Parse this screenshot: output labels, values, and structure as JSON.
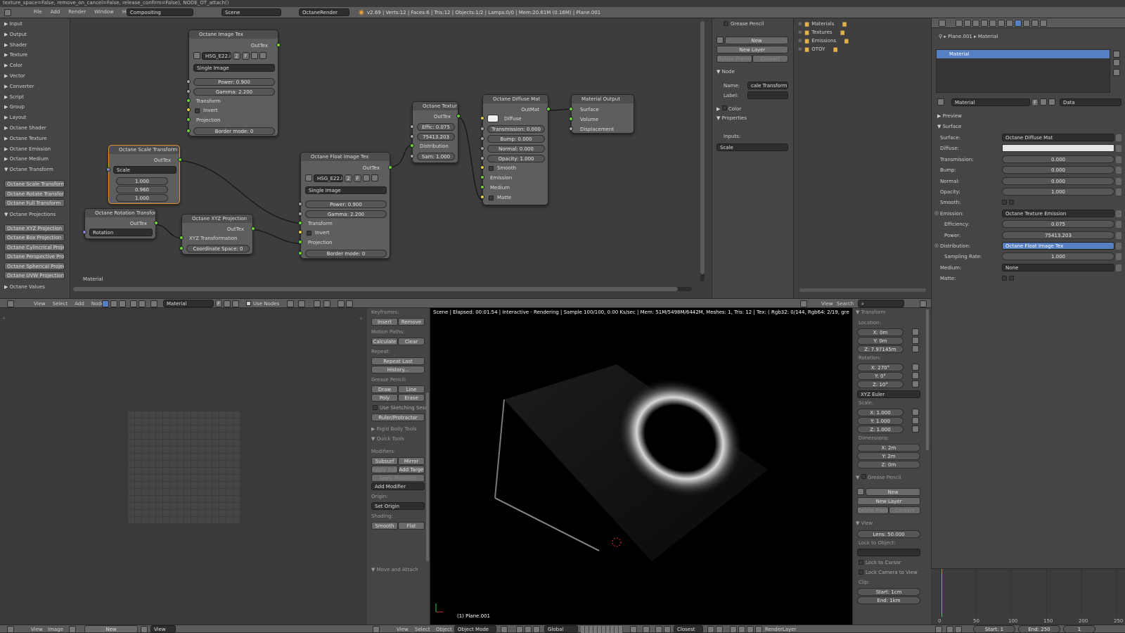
{
  "topline": "texture_space=False, remove_on_cancel=False, release_confirm=False), NODE_OT_attach()",
  "menubar": {
    "menus": [
      "File",
      "Add",
      "Render",
      "Window",
      "Help"
    ],
    "screen": "Compositing",
    "scene": "Scene",
    "engine": "OctaneRender",
    "stats": "v2.69 | Verts:12 | Faces:6 | Tris:12 | Objects:1/2 | Lamps:0/0 | Mem:20.61M (0.16M) | Plane.001"
  },
  "categories": [
    "Input",
    "Output",
    "Shader",
    "Texture",
    "Color",
    "Vector",
    "Converter",
    "Script",
    "Group",
    "Layout",
    "Octane Shader",
    "Octane Texture",
    "Octane Emission",
    "Octane Medium",
    "Octane Transform"
  ],
  "transform_buttons": [
    "Octane Scale Transform",
    "Octane Rotate Transform",
    "Octane Full Transform"
  ],
  "projections_header": "Octane Projections",
  "projection_buttons": [
    "Octane XYZ Projection",
    "Octane Box Projection",
    "Octane Cylincrical Projecti",
    "Octane Perspective Project",
    "Octane Spherical Projectio",
    "Octane UVW Projection"
  ],
  "values_header": "Octane Values",
  "nodes": {
    "img_tex": {
      "title": "Octane Image Tex",
      "out": "OutTex",
      "file": "HSG_E22.ies",
      "num": "2",
      "f": "F",
      "mode": "Single Image",
      "power": "Power: 0.900",
      "gamma": "Gamma: 2.200",
      "transform": "Transform",
      "invert": "Invert",
      "projection": "Projection",
      "border": "Border mode: 0"
    },
    "scale": {
      "title": "Octane Scale Transform",
      "out": "OutTex",
      "mode": "Scale",
      "v1": "1.000",
      "v2": "0.960",
      "v3": "1.000"
    },
    "rotation": {
      "title": "Octane Rotation Transform",
      "out": "OutTex",
      "mode": "Rotation"
    },
    "xyz": {
      "title": "Octane XYZ Projection",
      "out": "OutTex",
      "label": "XYZ Transformation",
      "coord": "Coordinate Space: 0"
    },
    "float_tex": {
      "title": "Octane Float Image Tex",
      "out": "OutTex",
      "file": "HSG_E22.ies",
      "num": "2",
      "f": "F",
      "mode": "Single Image",
      "power": "Power: 0.900",
      "gamma": "Gamma: 2.200",
      "transform": "Transform",
      "invert": "Invert",
      "projection": "Projection",
      "border": "Border mode: 0"
    },
    "texture": {
      "title": "Octane Textur",
      "out": "OutTex",
      "effic": "Effic: 0.075",
      "val": "75413.203",
      "dist": "Distribution",
      "sam": "Sam: 1.000"
    },
    "diffuse": {
      "title": "Octane Diffuse Mat",
      "out": "OutMat",
      "diffuse": "Diffuse",
      "transmission": "Transmission: 0.000",
      "bump": "Bump: 0.000",
      "normal": "Normal: 0.000",
      "opacity": "Opacity: 1.000",
      "smooth": "Smooth",
      "emission": "Emission",
      "medium": "Medium",
      "matte": "Matte"
    },
    "output": {
      "title": "Material Output",
      "surface": "Surface",
      "volume": "Volume",
      "displacement": "Displacement"
    }
  },
  "node_editor_label": "Material",
  "node_panel": {
    "grease_pencil": "Grease Pencil",
    "new": "New",
    "new_layer": "New Layer",
    "delete_frame": "Delete Frame",
    "convert": "Convert",
    "node": "Node",
    "name_label": "Name:",
    "name_val": "cale Transform",
    "label_label": "Label:",
    "color": "Color",
    "properties": "Properties",
    "inputs": "Inputs:",
    "scale": "Scale"
  },
  "node_header": {
    "menus": [
      "View",
      "Select",
      "Add",
      "Node"
    ],
    "material": "Material",
    "f": "F",
    "use_nodes": "Use Nodes"
  },
  "outliner": [
    "Materials",
    "Textures",
    "Emissions",
    "OTOY"
  ],
  "outliner_header": {
    "view": "View",
    "search": "Search"
  },
  "props": {
    "breadcrumb_obj": "Plane.001",
    "breadcrumb_mat": "Material",
    "slot": "Material",
    "mat_name": "Material",
    "f": "F",
    "data": "Data",
    "preview": "Preview",
    "surface_header": "Surface",
    "rows": [
      {
        "label": "Surface:",
        "value": "Octane Diffuse Mat",
        "kind": "sel"
      },
      {
        "label": "Diffuse:",
        "value": "",
        "kind": "white"
      },
      {
        "label": "Transmission:",
        "value": "0.000",
        "kind": "num"
      },
      {
        "label": "Bump:",
        "value": "0.000",
        "kind": "num"
      },
      {
        "label": "Normal:",
        "value": "0.000",
        "kind": "num"
      },
      {
        "label": "Opacity:",
        "value": "1.000",
        "kind": "num"
      },
      {
        "label": "Smooth:",
        "value": "",
        "kind": "chk"
      },
      {
        "label": "Emission:",
        "value": "Octane Texture Emission",
        "kind": "sel"
      },
      {
        "label": "Efficiency:",
        "value": "0.075",
        "kind": "num"
      },
      {
        "label": "Power:",
        "value": "75413.203",
        "kind": "num"
      },
      {
        "label": "Distribution:",
        "value": "Octane Float Image Tex",
        "kind": "blue"
      },
      {
        "label": "Sampling Rate:",
        "value": "1.000",
        "kind": "num"
      },
      {
        "label": "Medium:",
        "value": "None",
        "kind": "sel"
      },
      {
        "label": "Matte:",
        "value": "",
        "kind": "chk"
      }
    ]
  },
  "image_header": {
    "menus": [
      "View",
      "Image"
    ],
    "new": "New",
    "view": "View"
  },
  "tools": {
    "keyframes": "Keyframes:",
    "insert": "Insert",
    "remove": "Remove",
    "motion_paths": "Motion Paths:",
    "calculate": "Calculate",
    "clear": "Clear",
    "repeat": "Repeat:",
    "repeat_last": "Repeat Last",
    "history": "History...",
    "grease_pencil": "Grease Pencil:",
    "draw": "Draw",
    "line": "Line",
    "poly": "Poly",
    "erase": "Erase",
    "use_sketching": "Use Sketching Sessi",
    "ruler": "Ruler/Protractor",
    "rigid_body": "Rigid Body Tools",
    "quick_tools": "Quick Tools",
    "modifiers": "Modifiers:",
    "subsurf": "Subsurf",
    "mirror": "Mirror",
    "apply_sub": "Apply Sub",
    "add_target": "Add Targe",
    "apply_modifiers": "Apply Modifiers",
    "add_modifier": "Add Modifier",
    "origin": "Origin:",
    "set_origin": "Set Origin",
    "shading": "Shading:",
    "smooth": "Smooth",
    "flat": "Flat",
    "move_attach": "Move and Attach"
  },
  "viewport": {
    "status": "Scene | Elapsed: 00:01.54 | Interactive - Rendering | Sample 100/100, 0.00 Ks/sec | Mem: 51M/5498M/6442M, Meshes: 1, Tris: 12 | Tex: ( Rgb32: 0/144, Rgb64: 2/19, grey8: 0/68, grey16:",
    "object": "(1) Plane.001"
  },
  "npanel": {
    "transform": "Transform",
    "location": "Location:",
    "lx": "X: 0m",
    "ly": "Y: 0m",
    "lz": "Z: 7.97145m",
    "rotation": "Rotation:",
    "rx": "X: 270°",
    "ry": "Y: 0°",
    "rz": "Z: 10°",
    "euler": "XYZ Euler",
    "scale": "Scale:",
    "sx": "X: 1.000",
    "sy": "Y: 1.000",
    "sz": "Z: 1.000",
    "dimensions": "Dimensions:",
    "dx": "X: 2m",
    "dy": "Y: 2m",
    "dz": "Z: 0m",
    "gp": "Grease Pencil",
    "new": "New",
    "new_layer": "New Layer",
    "delete_frame": "Delete Frame",
    "convert": "Convert",
    "view": "View",
    "lens": "Lens: 50.000",
    "lock": "Lock to Object:",
    "lock_cursor": "Lock to Cursor",
    "lock_camera": "Lock Camera to View",
    "clip": "Clip:",
    "start": "Start: 1cm",
    "end": "End: 1km"
  },
  "view3d_header": {
    "menus": [
      "View",
      "Select",
      "Object"
    ],
    "mode": "Object Mode",
    "orientation": "Global",
    "snap": "Closest",
    "layer": "RenderLayer"
  },
  "timeline": {
    "ticks": [
      "0",
      "50",
      "100",
      "150",
      "200",
      "250"
    ],
    "start": "Start: 1",
    "end": "End: 250",
    "frame": "1"
  }
}
